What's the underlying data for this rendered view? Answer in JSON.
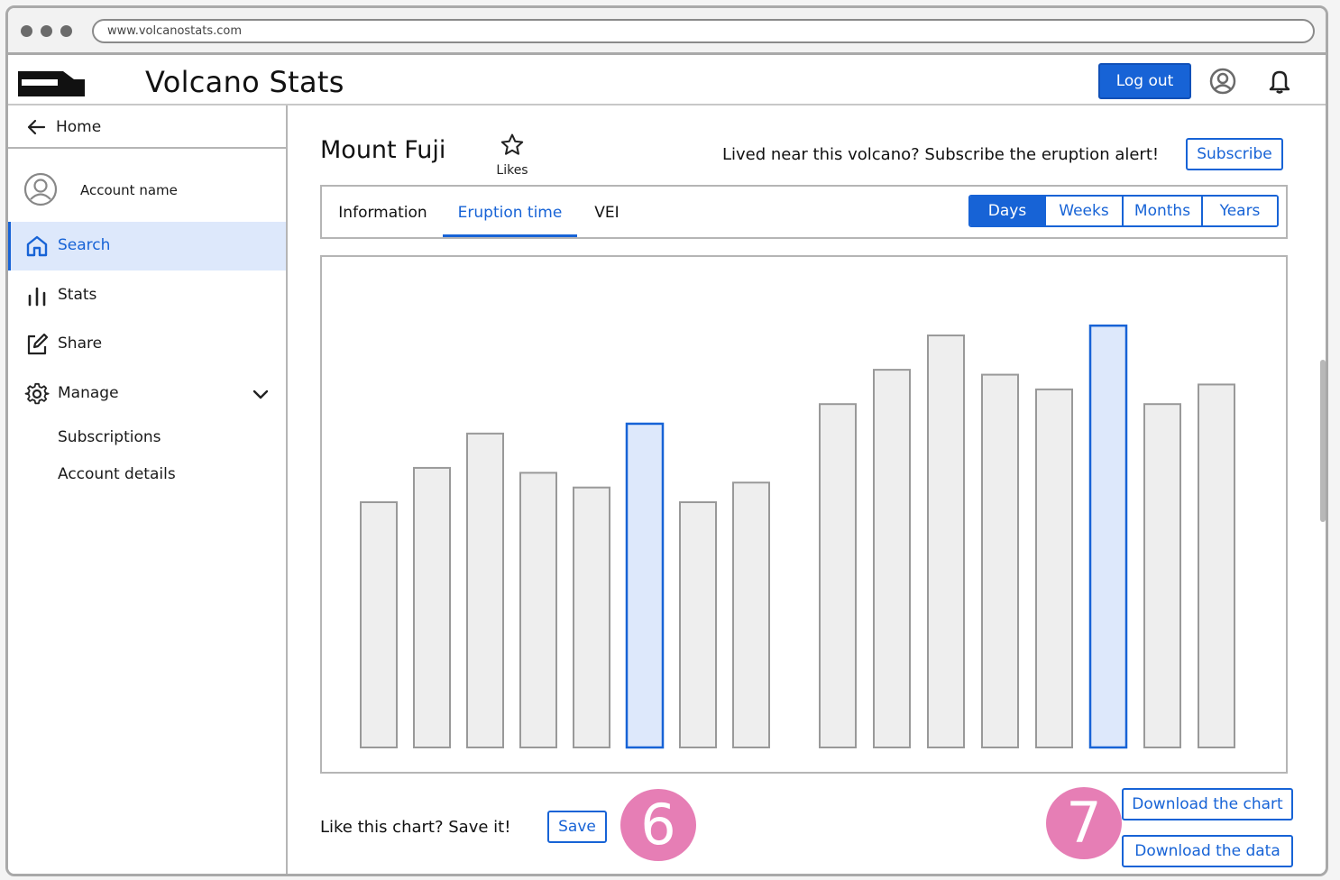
{
  "browser": {
    "url": "www.volcanostats.com"
  },
  "header": {
    "title": "Volcano Stats",
    "logout_label": "Log out"
  },
  "sidebar": {
    "home_label": "Home",
    "account_name": "Account name",
    "items": [
      {
        "label": "Search",
        "icon": "home-icon",
        "active": true
      },
      {
        "label": "Stats",
        "icon": "bar-chart-icon"
      },
      {
        "label": "Share",
        "icon": "edit-icon"
      },
      {
        "label": "Manage",
        "icon": "gear-icon"
      }
    ],
    "sub_items": [
      "Subscriptions",
      "Account details"
    ]
  },
  "main": {
    "volcano_name": "Mount Fuji",
    "likes_label": "Likes",
    "alert_text": "Lived near this volcano? Subscribe the eruption alert!",
    "subscribe_label": "Subscribe",
    "tabs": [
      "Information",
      "Eruption time",
      "VEI"
    ],
    "active_tab": 1,
    "periods": [
      "Days",
      "Weeks",
      "Months",
      "Years"
    ],
    "active_period": 0,
    "save_prompt": "Like this chart? Save it!",
    "save_label": "Save",
    "download_chart_label": "Download the chart",
    "download_data_label": "Download the data"
  },
  "annotations": {
    "badge_1": "6",
    "badge_2": "7"
  },
  "colors": {
    "accent": "#1763d6",
    "highlight_fill": "#dde8fb",
    "bar_fill": "#eeeeee",
    "badge": "#e67eb5"
  },
  "chart_data": {
    "type": "bar",
    "groups": [
      {
        "values": [
          50,
          57,
          64,
          56,
          53,
          66,
          50,
          54
        ],
        "highlighted": [
          5
        ]
      },
      {
        "values": [
          70,
          77,
          84,
          76,
          73,
          86,
          70,
          74
        ],
        "highlighted": [
          5
        ]
      }
    ],
    "ylim": [
      0,
      100
    ],
    "grid": false,
    "legend": "none"
  }
}
